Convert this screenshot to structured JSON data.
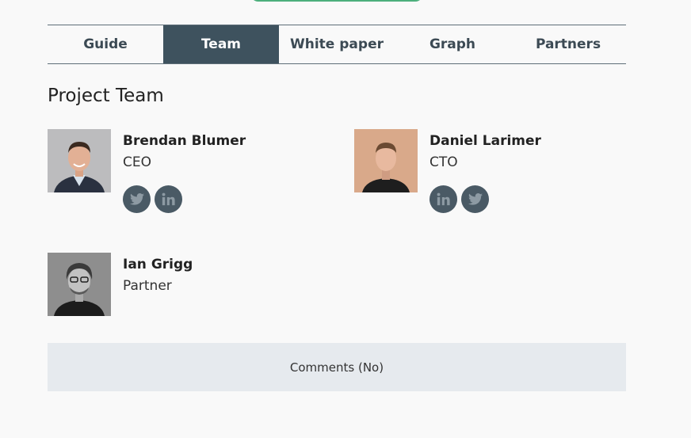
{
  "tabs": [
    {
      "label": "Guide",
      "active": false
    },
    {
      "label": "Team",
      "active": true
    },
    {
      "label": "White paper",
      "active": false
    },
    {
      "label": "Graph",
      "active": false
    },
    {
      "label": "Partners",
      "active": false
    }
  ],
  "section": {
    "title": "Project Team"
  },
  "members": [
    {
      "name": "Brendan Blumer",
      "role": "CEO",
      "socials": [
        "twitter-icon",
        "linkedin-icon"
      ]
    },
    {
      "name": "Daniel Larimer",
      "role": "CTO",
      "socials": [
        "linkedin-icon",
        "twitter-icon"
      ]
    },
    {
      "name": "Ian Grigg",
      "role": "Partner",
      "socials": []
    }
  ],
  "comments": {
    "label": "Comments (No)"
  },
  "colors": {
    "tab_active_bg": "#3e525e",
    "social_bg": "#4a5a65",
    "accent_green": "#4caf7c",
    "comments_bg": "#e6eaee"
  }
}
